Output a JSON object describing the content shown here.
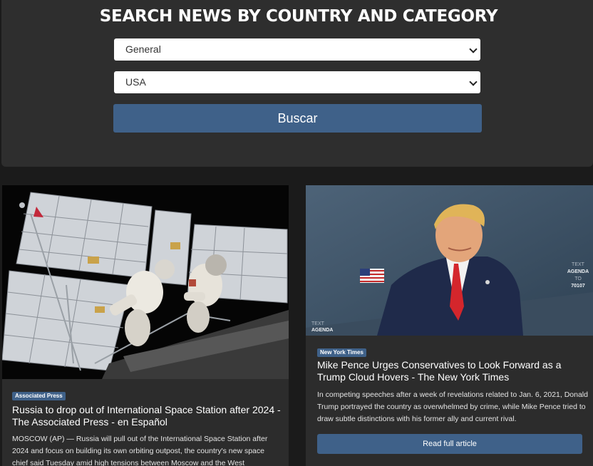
{
  "search": {
    "title": "SEARCH NEWS BY COUNTRY AND CATEGORY",
    "category_select": "General",
    "country_select": "USA",
    "button_label": "Buscar"
  },
  "articles": [
    {
      "source": "Associated Press",
      "title": "Russia to drop out of International Space Station after 2024 - The Associated Press - en Español",
      "description": "MOSCOW (AP) — Russia will pull out of the International Space Station after 2024 and focus on building its own orbiting outpost, the country's new space chief said Tuesday amid high tensions between Moscow and the West"
    },
    {
      "source": "New York Times",
      "title": "Mike Pence Urges Conservatives to Look Forward as a Trump Cloud Hovers - The New York Times",
      "description": "In competing speeches after a week of revelations related to Jan. 6, 2021, Donald Trump portrayed the country as overwhelmed by crime, while Mike Pence tried to draw subtle distinctions with his former ally and current rival.",
      "button_label": "Read full article",
      "image_backdrop_text": [
        "TEXT",
        "AGENDA",
        "TO",
        "70107"
      ],
      "image_corner_text": [
        "TEXT",
        "AGENDA"
      ]
    }
  ],
  "colors": {
    "accent": "#3f6189",
    "panel": "#2e2e2e",
    "background": "#1b1b1b"
  }
}
